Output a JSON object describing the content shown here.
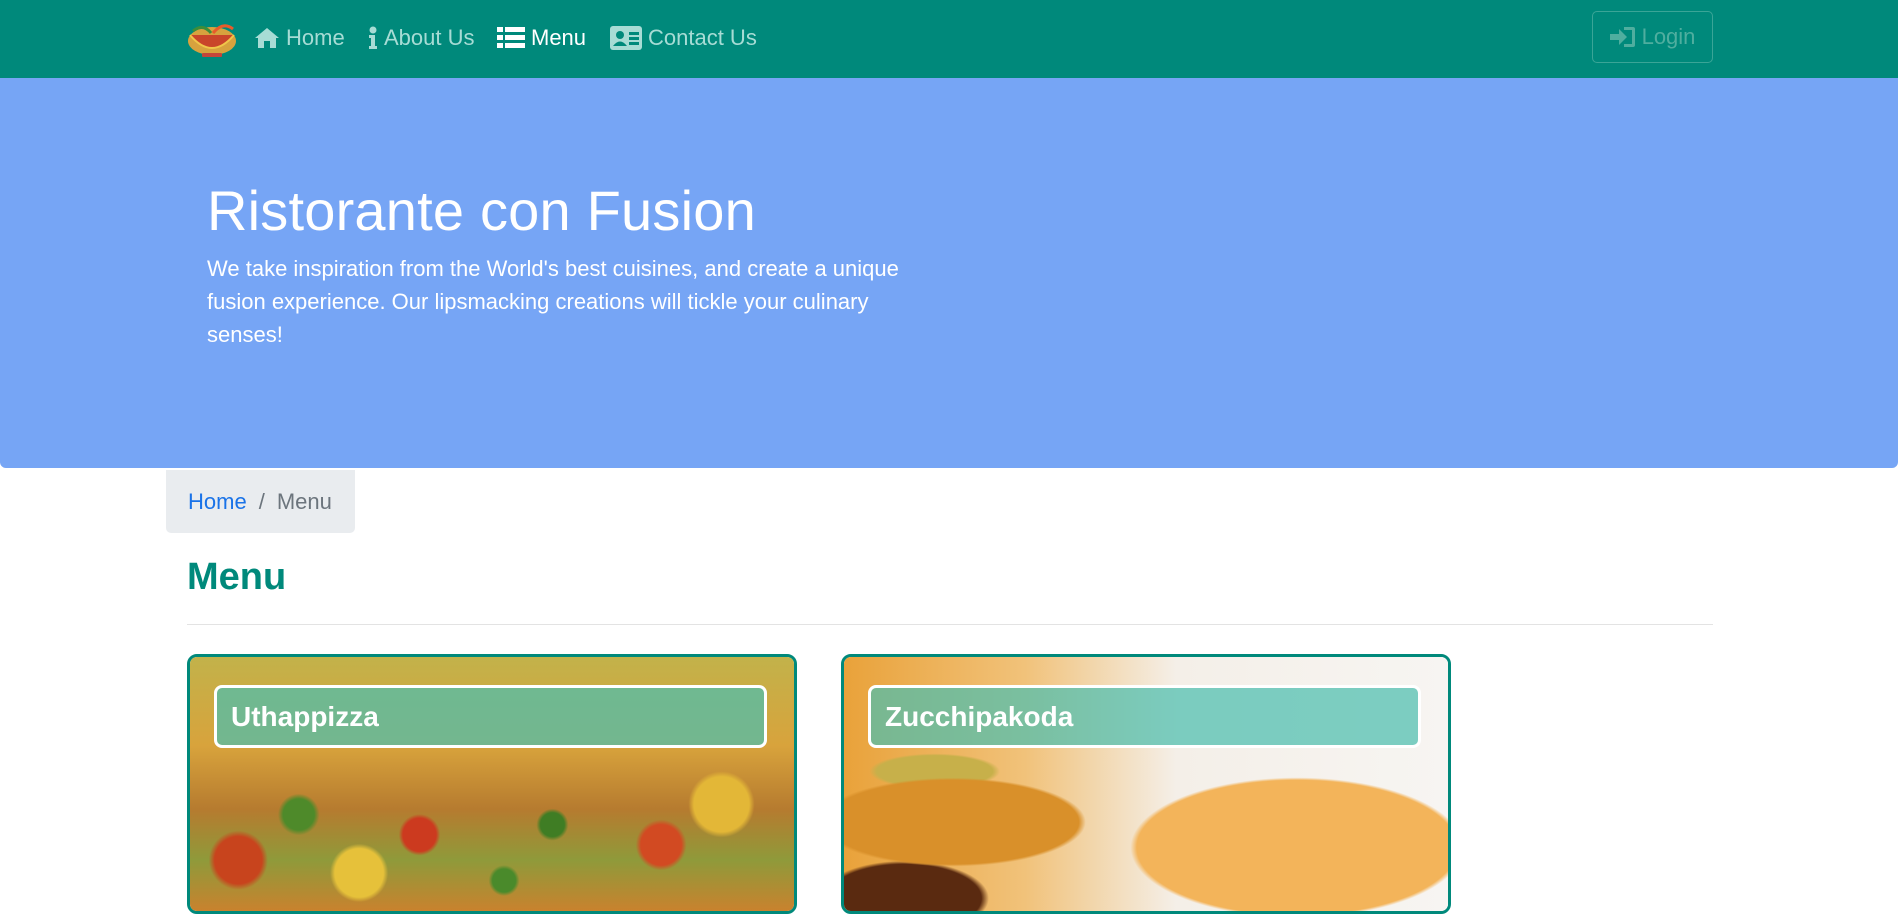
{
  "navbar": {
    "brand_icon": "restaurant-logo",
    "items": [
      {
        "label": "Home",
        "icon": "home-icon",
        "active": false
      },
      {
        "label": "About Us",
        "icon": "info-icon",
        "active": false
      },
      {
        "label": "Menu",
        "icon": "list-icon",
        "active": true
      },
      {
        "label": "Contact Us",
        "icon": "address-card-icon",
        "active": false
      }
    ],
    "login_label": "Login",
    "login_icon": "sign-in-icon",
    "colors": {
      "background": "#00897b",
      "active_text": "#ffffff",
      "inactive_text": "#a7dcd5"
    }
  },
  "jumbotron": {
    "title": "Ristorante con Fusion",
    "text": "We take inspiration from the World's best cuisines, and create a unique fusion experience. Our lipsmacking creations will tickle your culinary senses!",
    "background": "#76a5f5"
  },
  "breadcrumb": {
    "home_label": "Home",
    "separator": "/",
    "current_label": "Menu"
  },
  "page": {
    "heading": "Menu",
    "heading_color": "#00897b"
  },
  "dishes": [
    {
      "name": "Uthappizza"
    },
    {
      "name": "Zucchipakoda"
    }
  ]
}
